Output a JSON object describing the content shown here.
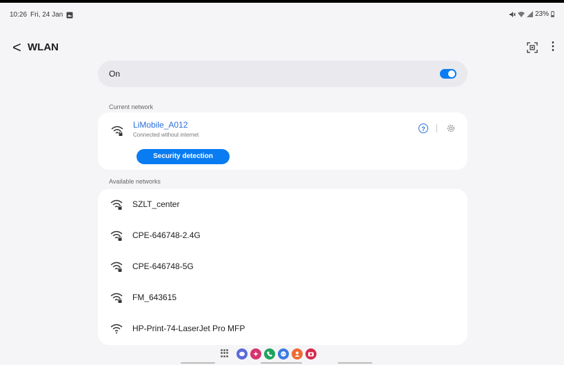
{
  "status": {
    "time": "10:26",
    "date": "Fri, 24 Jan",
    "battery": "23%"
  },
  "header": {
    "title": "WLAN",
    "back_glyph": "<",
    "more_glyph": "⋮"
  },
  "toggle": {
    "label": "On",
    "state": "on"
  },
  "current": {
    "section_label": "Current network",
    "name": "LiMobile_A012",
    "subtitle": "Connected without internet",
    "help_glyph": "?",
    "button_label": "Security detection"
  },
  "available": {
    "section_label": "Available networks",
    "networks": [
      {
        "name": "SZLT_center",
        "locked": true
      },
      {
        "name": "CPE-646748-2.4G",
        "locked": true
      },
      {
        "name": "CPE-646748-5G",
        "locked": true
      },
      {
        "name": "FM_643615",
        "locked": true
      },
      {
        "name": "HP-Print-74-LaserJet Pro MFP",
        "locked": false
      }
    ]
  },
  "colors": {
    "accent": "#0a7cf2",
    "link": "#2a6ed8"
  },
  "dock_apps": [
    {
      "icon": "messages-icon",
      "color": "#5b6bd9"
    },
    {
      "icon": "galaxy-store-icon",
      "color": "#d6336c"
    },
    {
      "icon": "phone-icon",
      "color": "#1fa35c"
    },
    {
      "icon": "chat-icon",
      "color": "#3d7be3"
    },
    {
      "icon": "contacts-icon",
      "color": "#f06a32"
    },
    {
      "icon": "camera-icon",
      "color": "#d62b4b"
    }
  ]
}
